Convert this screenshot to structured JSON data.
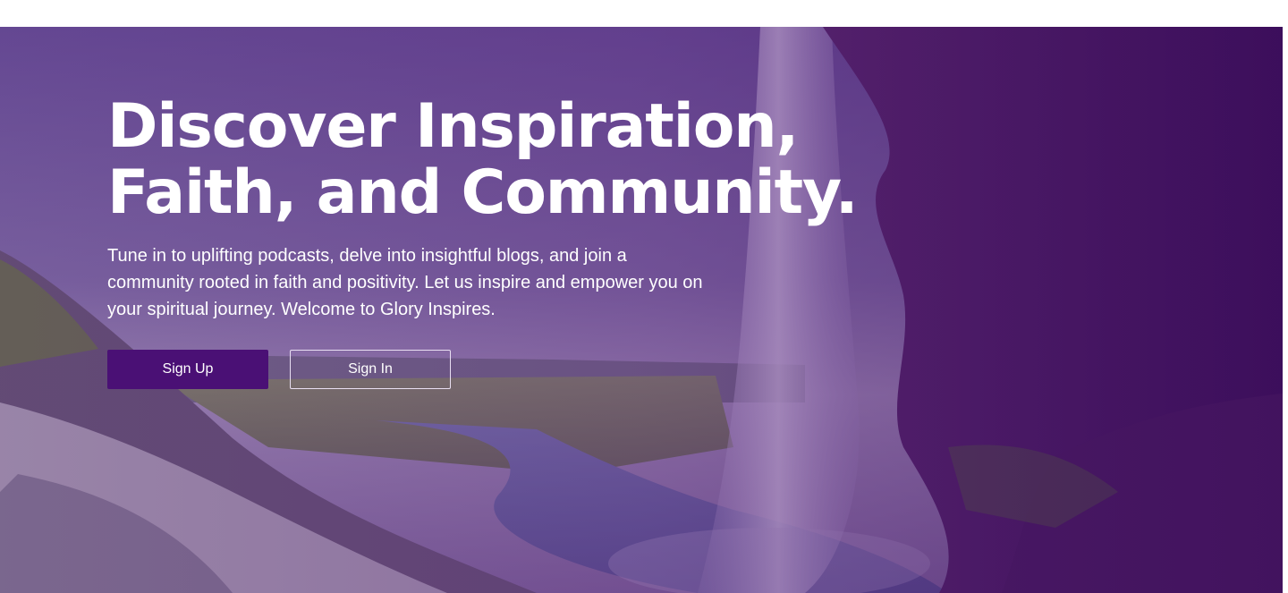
{
  "hero": {
    "title_line1": "Discover Inspiration,",
    "title_line2": "Faith, and Community.",
    "description": "Tune in to uplifting podcasts, delve into insightful blogs, and join a community rooted in faith and positivity. Let us inspire and empower you on your spiritual journey. Welcome to Glory Inspires.",
    "background": "waterfall-landscape-image"
  },
  "buttons": {
    "sign_up": "Sign Up",
    "sign_in": "Sign In"
  },
  "colors": {
    "primary": "#4a1075",
    "overlay": "#5a2080",
    "text": "#ffffff"
  }
}
